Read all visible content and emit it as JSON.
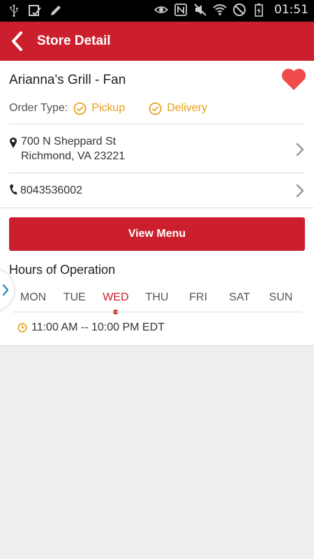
{
  "status_bar": {
    "time": "01:51",
    "left_icons": [
      "usb-icon",
      "checkbox-notification-icon",
      "pen-icon"
    ],
    "right_icons": [
      "eye-icon",
      "nfc-icon",
      "mute-icon",
      "wifi-icon",
      "no-sim-icon",
      "battery-icon"
    ]
  },
  "app_bar": {
    "title": "Store Detail",
    "color": "#cc1f2d"
  },
  "store": {
    "name": "Arianna's Grill - Fan",
    "favorite": true,
    "order_type_label": "Order Type:",
    "order_types": [
      "Pickup",
      "Delivery"
    ],
    "address_line1": "700 N Sheppard St",
    "address_line2": "Richmond, VA 23221",
    "phone": "8043536002"
  },
  "actions": {
    "view_menu_label": "View Menu"
  },
  "hours": {
    "title": "Hours of Operation",
    "days": [
      "MON",
      "TUE",
      "WED",
      "THU",
      "FRI",
      "SAT",
      "SUN"
    ],
    "selected_day": "WED",
    "selected_hours": "11:00 AM -- 10:00 PM EDT"
  },
  "colors": {
    "accent": "#cc1f2d",
    "order_option": "#e6a017",
    "heart": "#f04b4b"
  }
}
